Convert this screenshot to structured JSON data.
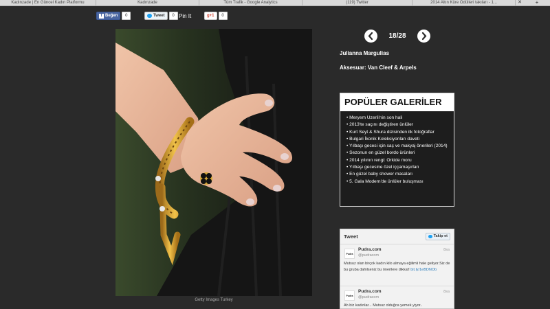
{
  "browser": {
    "tabs": [
      {
        "title": "Kadınzade | En Güncel Kadın Platformu"
      },
      {
        "title": "Kadınzade"
      },
      {
        "title": "Tüm Trafik - Google Analytics"
      },
      {
        "title": "(119) Twitter"
      },
      {
        "title": "2014 Altın Küre Ödülleri takıları - 1..."
      }
    ],
    "close_glyph": "✕",
    "new_tab_glyph": "+"
  },
  "share": {
    "facebook_label": "Beğen",
    "facebook_count": "0",
    "twitter_label": "Tweet",
    "twitter_count": "0",
    "pinterest_label": "Pin It",
    "gplus_label": "g+1",
    "gplus_count": "0"
  },
  "gallery": {
    "counter": "18/28",
    "prev_icon": "chevron-left-icon",
    "next_icon": "chevron-right-icon",
    "celebrity": "Julianna Margulias",
    "accessory": "Aksesuar: Van Cleef & Arpels",
    "photo_credit": "Getty Images Turkey"
  },
  "popular": {
    "heading": "POPÜLER GALERİLER",
    "items": [
      "• Meryem Uzerli'nin son hali",
      "• 2013'te saçını değiştiren ünlüler",
      "• Kurt Seyt & Shura dizisinden ilk fotoğraflar",
      "• Bulgari İkonik Koleksiyonları daveti",
      "• Yılbaşı gecesi için saç ve makyaj önerileri (2014)",
      "• Sezonun en güzel bordo ürünleri",
      "• 2014 yılının rengi: Orkide moru",
      "• Yılbaşı gecesine özel iççamaşırları",
      "• En güzel baby shower masaları",
      "• 5. Gala Modern'de ünlüler buluşması"
    ]
  },
  "twitter": {
    "heading": "Tweet",
    "follow_label": "Takip et",
    "tweets": [
      {
        "avatar": "Pudra",
        "name": "Pudra.com",
        "handle": "@pudracom",
        "time": "8sa",
        "text": "Mutsuz olan birçok kadın kilo almaya eğilimli hale geliyor.Siz de bu gruba dahilseniz bu önerilere dikkat!",
        "link": "bit.ly/1eBDNOb"
      },
      {
        "avatar": "Pudra",
        "name": "Pudra.com",
        "handle": "@pudracom",
        "time": "8sa",
        "text": "Ah biz kadınlar... Mutsuz olduğca yemek yiyor..",
        "link": ""
      }
    ]
  },
  "colors": {
    "background": "#2a2a2a",
    "panel": "#1d1d1d",
    "twitter_blue": "#1da1f2",
    "facebook_blue": "#3b5998"
  }
}
